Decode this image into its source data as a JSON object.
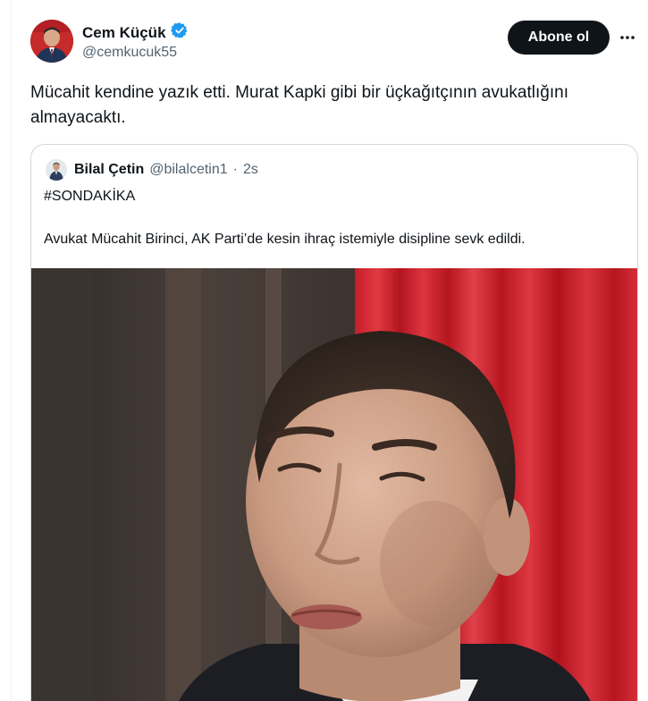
{
  "author": {
    "display_name": "Cem Küçük",
    "handle": "@cemkucuk55",
    "verified_icon": "verified-badge-icon",
    "avatar_icon": "profile-photo"
  },
  "actions": {
    "subscribe_label": "Abone ol",
    "more_icon": "more-dots-icon"
  },
  "tweet": {
    "text": "Mücahit kendine yazık etti. Murat Kapki gibi bir üçkağıtçının avukatlığını almayacaktı."
  },
  "quote": {
    "display_name": "Bilal Çetin",
    "handle": "@bilalcetin1",
    "separator": "·",
    "time": "2s",
    "hashtag": "#SONDAKİKA",
    "body": "Avukat Mücahit Birinci, AK Parti’de kesin ihraç istemiyle disipline sevk edildi.",
    "media": "photo-of-man-in-front-of-red-curtain"
  },
  "colors": {
    "text_primary": "#0f1419",
    "text_secondary": "#536471",
    "verified_blue": "#1d9bf0",
    "button_dark": "#0f1419",
    "border": "#cfd9de"
  }
}
